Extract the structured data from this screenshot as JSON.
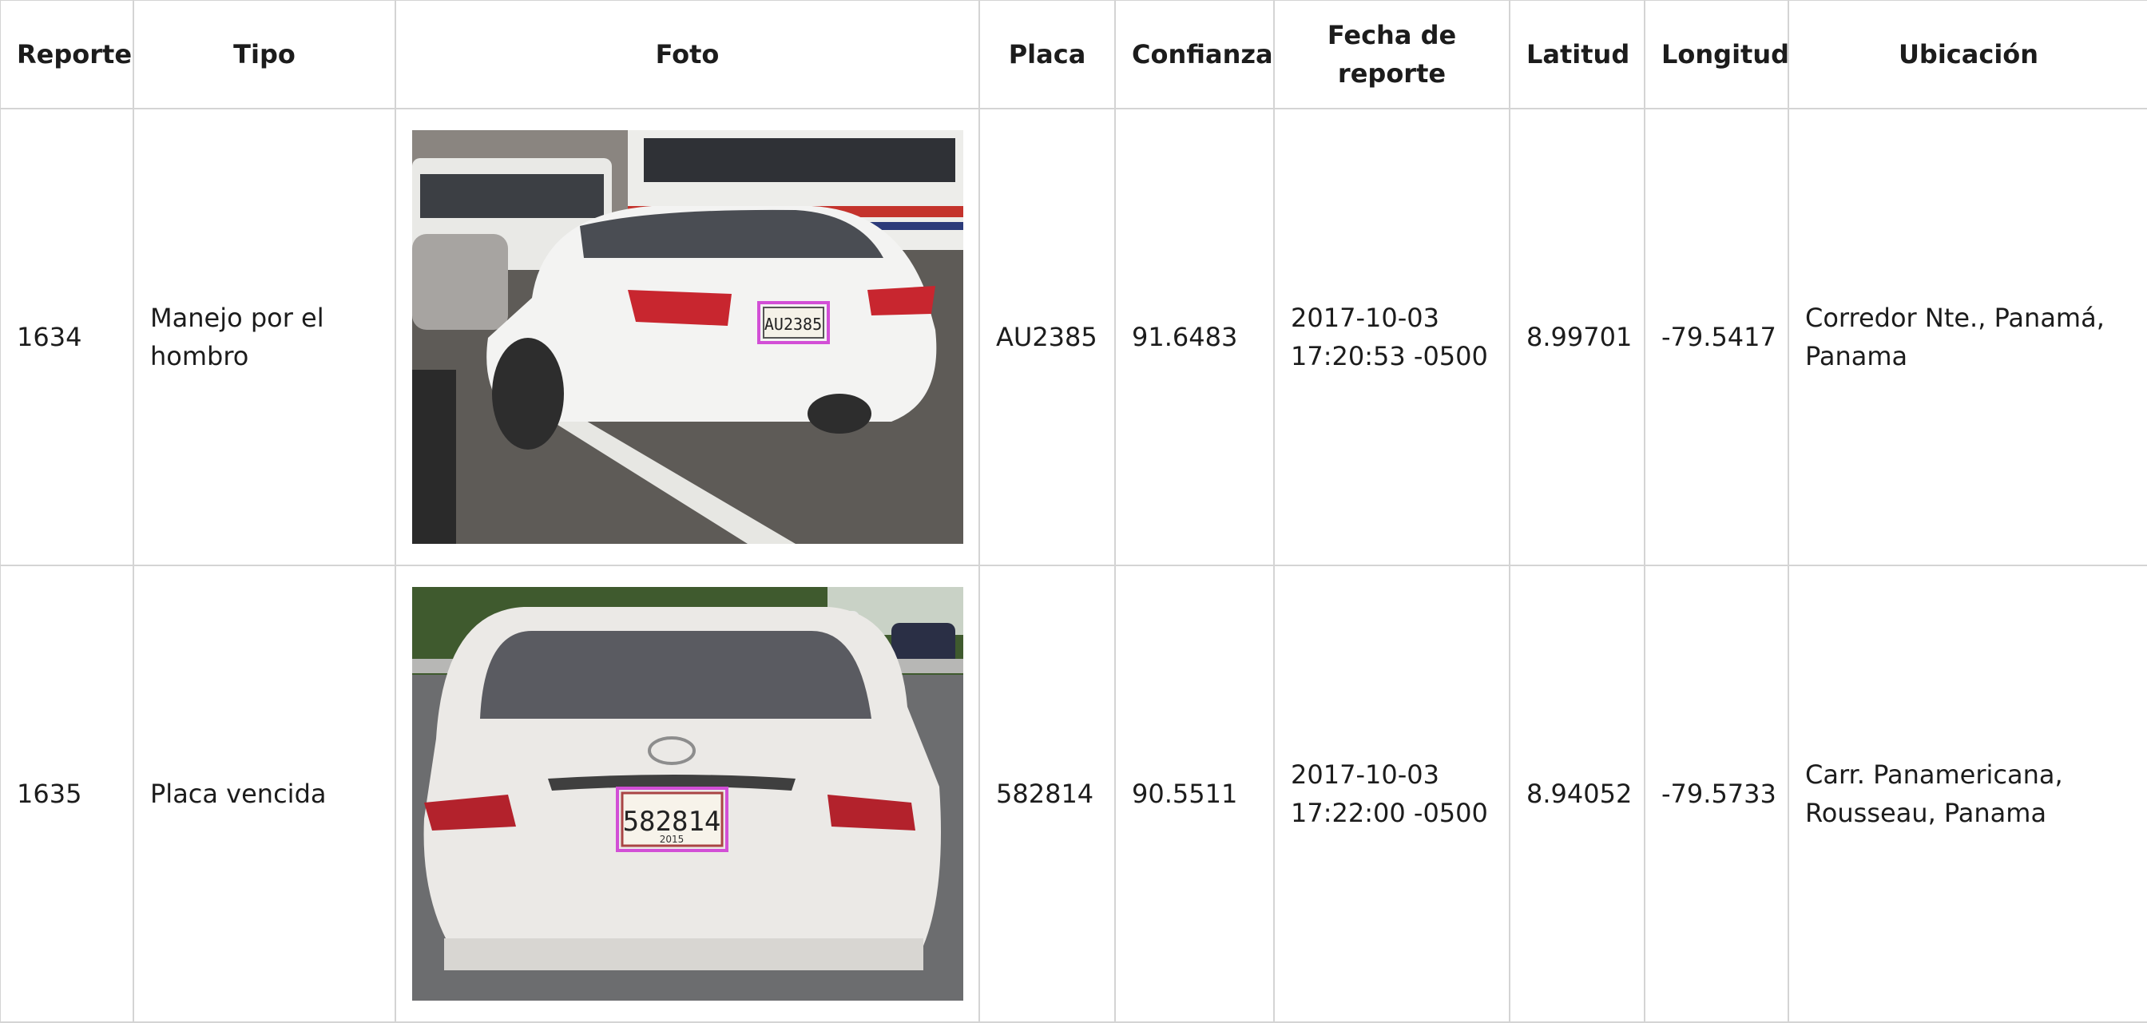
{
  "table": {
    "headers": [
      "Reporte",
      "Tipo",
      "Foto",
      "Placa",
      "Confianza",
      "Fecha de reporte",
      "Latitud",
      "Longitud",
      "Ubicación"
    ],
    "rows": [
      {
        "reporte": "1634",
        "tipo": "Manejo por el hombro",
        "foto": {
          "icon": "car-photo-nissan-sentra",
          "plate_text": "AU2385",
          "car_color": "#f2f2f2",
          "box_color": "#d24fd6"
        },
        "placa": "AU2385",
        "confianza": "91.6483",
        "fecha": "2017-10-03 17:20:53 -0500",
        "latitud": "8.99701",
        "longitud": "-79.5417",
        "ubicacion": "Corredor Nte., Panamá, Panama"
      },
      {
        "reporte": "1635",
        "tipo": "Placa vencida",
        "foto": {
          "icon": "car-photo-toyota-yaris",
          "plate_text": "582814",
          "plate_year": "2015",
          "car_color": "#ebe9e6",
          "box_color": "#d24fd6"
        },
        "placa": "582814",
        "confianza": "90.5511",
        "fecha": "2017-10-03 17:22:00 -0500",
        "latitud": "8.94052",
        "longitud": "-79.5733",
        "ubicacion": "Carr. Panamericana, Rousseau, Panama"
      }
    ]
  }
}
